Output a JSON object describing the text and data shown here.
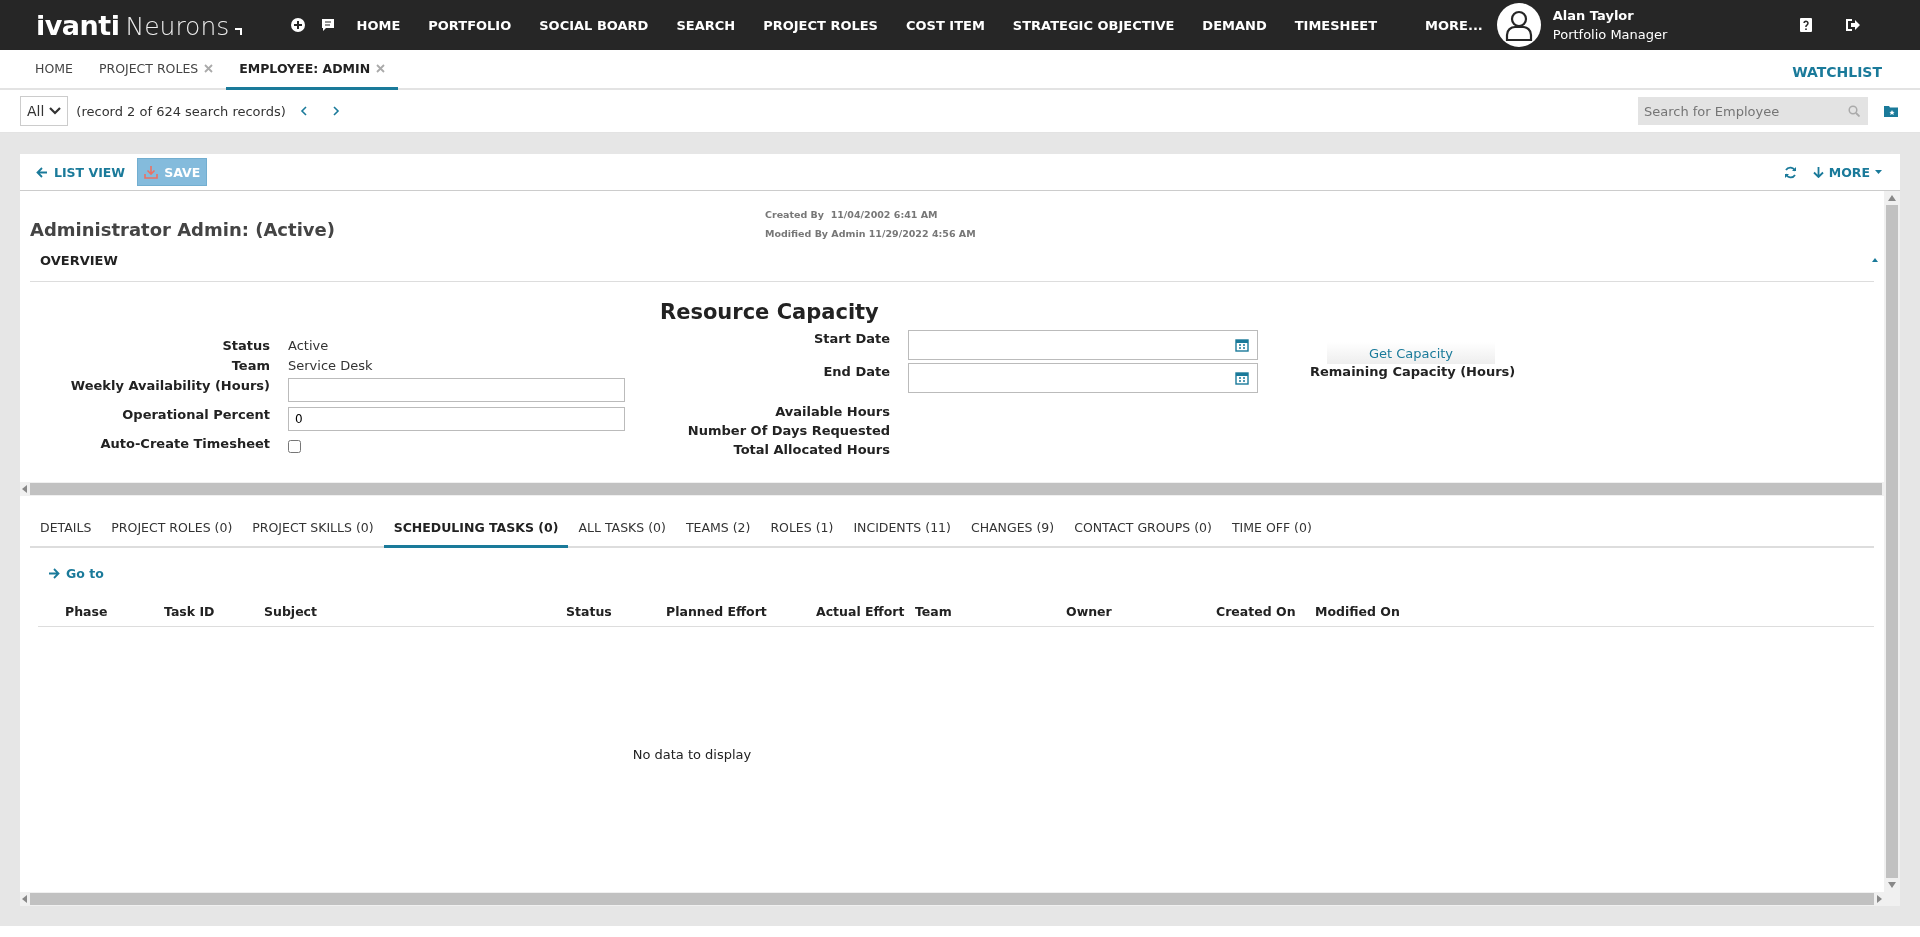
{
  "app": {
    "brand": "ivanti",
    "product": "Neurons"
  },
  "nav": [
    "HOME",
    "PORTFOLIO",
    "SOCIAL BOARD",
    "SEARCH",
    "PROJECT ROLES",
    "COST ITEM",
    "STRATEGIC OBJECTIVE",
    "DEMAND",
    "TIMESHEET",
    "MORE..."
  ],
  "user": {
    "name": "Alan Taylor",
    "role": "Portfolio Manager"
  },
  "page_tabs": [
    {
      "label": "HOME",
      "closable": false,
      "selected": false
    },
    {
      "label": "PROJECT ROLES",
      "closable": true,
      "selected": false
    },
    {
      "label": "EMPLOYEE: ADMIN",
      "closable": true,
      "selected": true
    }
  ],
  "watchlist": "WATCHLIST",
  "record_bar": {
    "filter": "All",
    "info": "(record 2 of 624 search records)",
    "search_placeholder": "Search for Employee"
  },
  "toolbar": {
    "list_view": "LIST VIEW",
    "save": "SAVE",
    "save_disabled": true,
    "more": "MORE"
  },
  "record": {
    "title": "Administrator Admin: (Active)",
    "created": "Created By  11/04/2002 6:41 AM",
    "modified": "Modified By Admin 11/29/2022 4:56 AM"
  },
  "section": {
    "title": "OVERVIEW",
    "expanded": true
  },
  "fields": [
    {
      "kind": "text",
      "label": "Status",
      "value": "Active"
    },
    {
      "kind": "text",
      "label": "Team",
      "value": "Service Desk"
    },
    {
      "kind": "input",
      "label": "Weekly Availability (Hours)"
    },
    {
      "kind": "input",
      "label": "Operational Percent",
      "value": "0"
    },
    {
      "kind": "checkbox",
      "label": "Auto-Create Timesheet",
      "checked": false
    }
  ],
  "capacity": {
    "title": "Resource Capacity",
    "fields": [
      {
        "kind": "date",
        "label": "Start Date"
      },
      {
        "kind": "date",
        "label": "End Date"
      },
      {
        "kind": "label",
        "label": "Available Hours"
      },
      {
        "kind": "label",
        "label": "Number Of Days Requested"
      },
      {
        "kind": "label",
        "label": "Total Allocated Hours"
      }
    ],
    "button": "Get Capacity",
    "remaining_label": "Remaining Capacity (Hours)"
  },
  "detail_tabs": [
    {
      "label": "DETAILS",
      "selected": false
    },
    {
      "label": "PROJECT ROLES (0)",
      "selected": false
    },
    {
      "label": "PROJECT SKILLS (0)",
      "selected": false
    },
    {
      "label": "SCHEDULING TASKS (0)",
      "selected": true
    },
    {
      "label": "ALL TASKS (0)",
      "selected": false
    },
    {
      "label": "TEAMS (2)",
      "selected": false
    },
    {
      "label": "ROLES (1)",
      "selected": false
    },
    {
      "label": "INCIDENTS (11)",
      "selected": false
    },
    {
      "label": "CHANGES (9)",
      "selected": false
    },
    {
      "label": "CONTACT GROUPS (0)",
      "selected": false
    },
    {
      "label": "TIME OFF (0)",
      "selected": false
    }
  ],
  "go_to": "Go to",
  "table": {
    "columns": [
      "Phase",
      "Task ID",
      "Subject",
      "Status",
      "Planned Effort",
      "Actual Effort",
      "Team",
      "Owner",
      "Created On",
      "Modified On"
    ],
    "empty_text": "No data to display"
  }
}
